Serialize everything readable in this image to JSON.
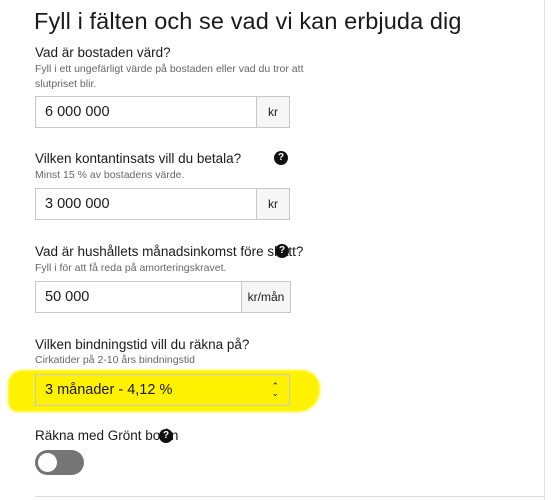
{
  "title": "Fyll i fälten och se vad vi kan erbjuda dig",
  "fields": [
    {
      "label": "Vad är bostaden värd?",
      "help": "Fyll i ett ungefärligt värde på bostaden eller vad du tror att slutpriset blir.",
      "value": "6 000 000",
      "unit": "kr"
    },
    {
      "label": "Vilken kontantinsats vill du betala?",
      "help": "Minst 15 % av bostadens värde.",
      "value": "3 000 000",
      "unit": "kr"
    },
    {
      "label": "Vad är hushållets månadsinkomst före skatt?",
      "help": "Fyll i för att få reda på amorteringskravet.",
      "value": "50 000",
      "unit": "kr/mån"
    }
  ],
  "binding": {
    "label": "Vilken bindningstid vill du räkna på?",
    "help": "Cirkatider på 2-10 års bindningstid",
    "selected": "3 månader - 4,12 %"
  },
  "green_loan": {
    "label": "Räkna med Grönt bolån",
    "enabled": false
  },
  "icons": {
    "help": "question-circle-icon",
    "select": "chevron-up-down-icon"
  },
  "colors": {
    "highlight": "#fff200",
    "toggle_off": "#757575",
    "help_icon": "#111111"
  }
}
